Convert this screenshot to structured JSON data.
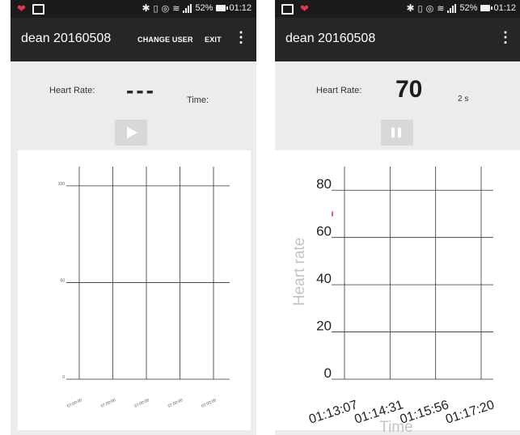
{
  "status_bar": {
    "battery": "52%",
    "time": "01:12"
  },
  "left": {
    "app_title": "dean 20160508",
    "actions": [
      "CHANGE USER",
      "EXIT"
    ],
    "heart_rate_label": "Heart Rate:",
    "heart_rate_value": "---",
    "time_label": "Time:",
    "control_button": "play-icon",
    "chart_data": {
      "type": "line",
      "title": "",
      "xlabel": "",
      "ylabel": "",
      "y_ticks": [
        0,
        50,
        100
      ],
      "ylim": [
        0,
        110
      ],
      "x_ticks": [
        "07:00:00",
        "07:00:00",
        "07:00:00",
        "07:00:00",
        "07:00:00"
      ],
      "grid": true,
      "series": []
    }
  },
  "right": {
    "app_title": "dean 20160508",
    "heart_rate_label": "Heart Rate:",
    "heart_rate_value": "70",
    "elapsed": "2 s",
    "control_button": "pause-icon",
    "chart_data": {
      "type": "line",
      "title": "",
      "xlabel": "Time",
      "ylabel": "Heart rate",
      "y_ticks": [
        0,
        20,
        40,
        60,
        80
      ],
      "ylim": [
        0,
        90
      ],
      "x_ticks": [
        "01:13:07",
        "01:14:31",
        "01:15:56",
        "01:17:20"
      ],
      "grid": true,
      "series": [
        {
          "color": "#e03030",
          "x": [
            "01:13:07"
          ],
          "values": [
            70
          ]
        }
      ]
    }
  }
}
